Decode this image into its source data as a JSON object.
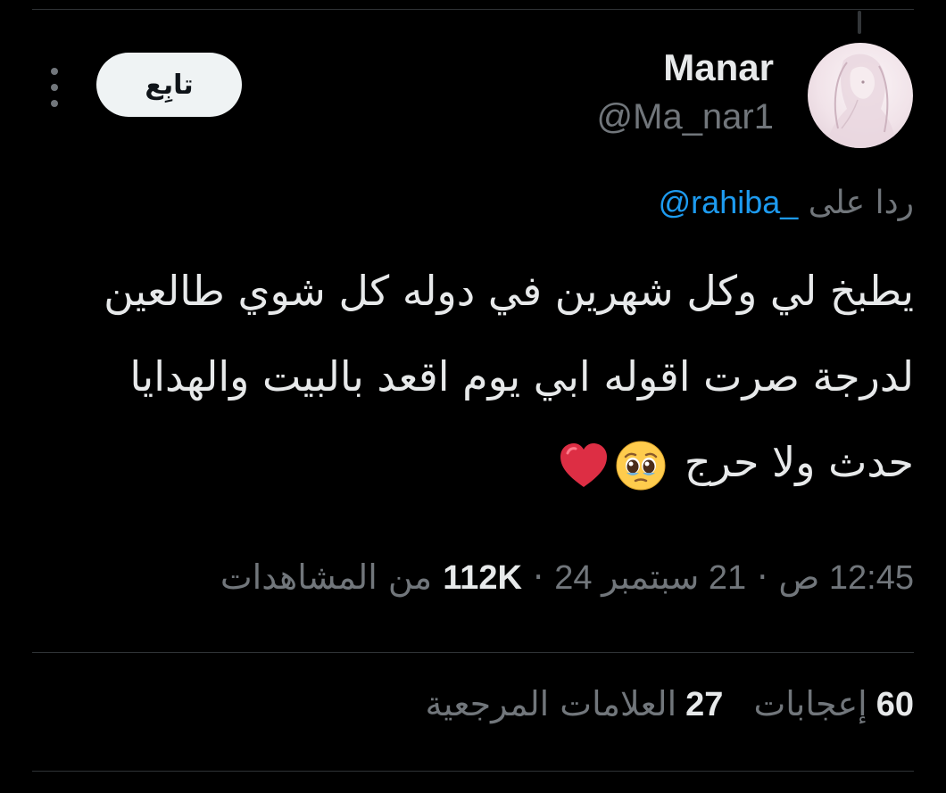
{
  "author": {
    "display_name": "Manar",
    "handle": "@Ma_nar1",
    "avatar_icon": "profile-photo"
  },
  "actions": {
    "follow_label": "تابِع",
    "more_icon": "vertical-ellipsis-icon"
  },
  "reply": {
    "label": "ردا على",
    "mention": "@rahiba_"
  },
  "tweet": {
    "lines": [
      "يطبخ لي وكل شهرين في دوله كل شوي طالعين",
      "لدرجة صرت اقوله ابي يوم اقعد بالبيت والهدايا",
      "حدث ولا حرج"
    ],
    "emojis": [
      "pleading-face-emoji",
      "red-heart-emoji"
    ]
  },
  "meta": {
    "time": "12:45 ص",
    "separator": "·",
    "date": "21 سبتمبر 24",
    "views_count": "112K",
    "views_label": "من المشاهدات"
  },
  "stats": {
    "likes_count": "60",
    "likes_label": "إعجابات",
    "bookmarks_count": "27",
    "bookmarks_label": "العلامات المرجعية"
  },
  "colors": {
    "background": "#000000",
    "text_primary": "#e7e9ea",
    "text_secondary": "#71767b",
    "link": "#1d9bf0",
    "divider": "#2f3336",
    "follow_button_bg": "#eff3f4"
  }
}
